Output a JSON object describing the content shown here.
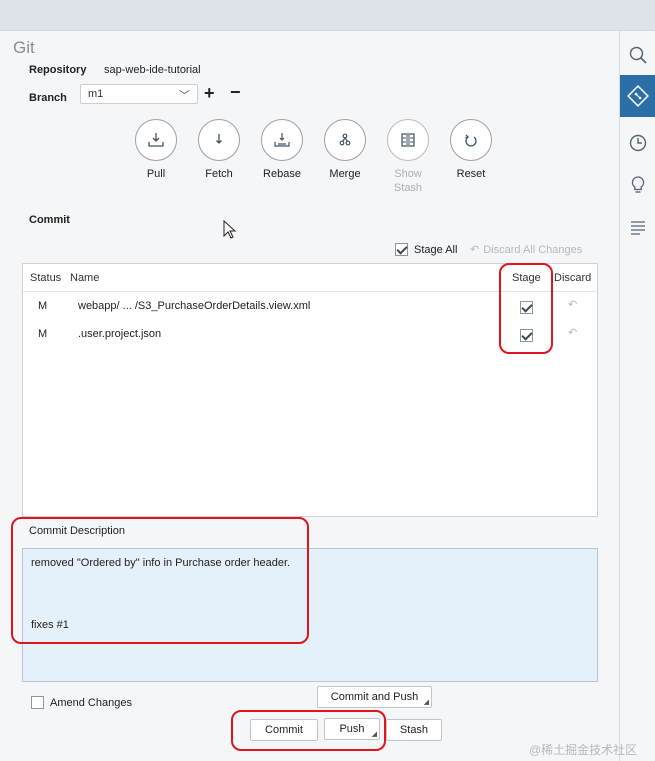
{
  "panel": {
    "title": "Git"
  },
  "repository": {
    "label": "Repository",
    "value": "sap-web-ide-tutorial"
  },
  "branch": {
    "label": "Branch",
    "selected": "m1",
    "add": "+",
    "remove": "−"
  },
  "actions": [
    {
      "label": "Pull",
      "icon": "pull-icon"
    },
    {
      "label": "Fetch",
      "icon": "fetch-icon"
    },
    {
      "label": "Rebase",
      "icon": "rebase-icon"
    },
    {
      "label": "Merge",
      "icon": "merge-icon"
    },
    {
      "label": "Show\nStash",
      "icon": "stash-icon",
      "disabled": true
    },
    {
      "label": "Reset",
      "icon": "reset-icon"
    }
  ],
  "commit": {
    "section_label": "Commit",
    "stage_all": "Stage All",
    "discard_all": "Discard All Changes",
    "columns": {
      "status": "Status",
      "name": "Name",
      "stage": "Stage",
      "discard": "Discard"
    },
    "files": [
      {
        "status": "M",
        "name": "webapp/ ... /S3_PurchaseOrderDetails.view.xml",
        "staged": true
      },
      {
        "status": "M",
        "name": ".user.project.json",
        "staged": true
      }
    ],
    "description_label": "Commit Description",
    "description_line1": "removed \"Ordered by\" info in Purchase order header.",
    "description_line2": "fixes #1",
    "amend": "Amend Changes",
    "commit_and_push": "Commit and Push",
    "commit_btn": "Commit",
    "push_btn": "Push",
    "stash_btn": "Stash"
  },
  "watermark": "@稀土掘金技术社区",
  "colors": {
    "highlight": "#e0141c",
    "active_tab": "#2c6ea6",
    "description_bg": "#e4f1fa"
  }
}
